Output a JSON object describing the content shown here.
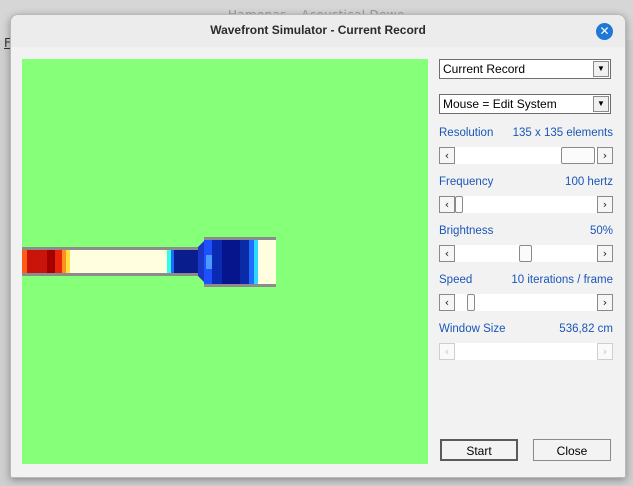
{
  "background": {
    "window_title": "Hamonas – Acoustical Dewe",
    "menu_letter": "F"
  },
  "dialog": {
    "title": "Wavefront Simulator - Current Record"
  },
  "controls": {
    "record_select": "Current Record",
    "mouse_select": "Mouse = Edit System",
    "resolution": {
      "label": "Resolution",
      "value": "135 x 135 elements"
    },
    "frequency": {
      "label": "Frequency",
      "value": "100 hertz"
    },
    "brightness": {
      "label": "Brightness",
      "value": "50%"
    },
    "speed": {
      "label": "Speed",
      "value": "10 iterations / frame"
    },
    "window_size": {
      "label": "Window Size",
      "value": "536,82 cm"
    }
  },
  "buttons": {
    "start": "Start",
    "close": "Close"
  },
  "colors": {
    "field": "#86ff79",
    "accent_label": "#1a56b8",
    "close_icon": "#1e78d6"
  }
}
